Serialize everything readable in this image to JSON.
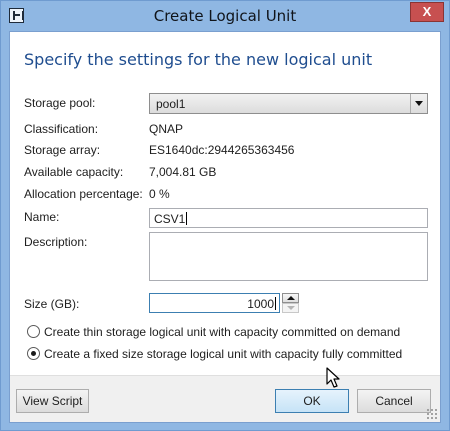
{
  "window": {
    "title": "Create Logical Unit",
    "close_glyph": "X",
    "accent_color": "#8fb7e3"
  },
  "heading": "Specify the settings for the new logical unit",
  "fields": {
    "storage_pool": {
      "label": "Storage pool:",
      "value": "pool1"
    },
    "classification": {
      "label": "Classification:",
      "value": "QNAP"
    },
    "storage_array": {
      "label": "Storage array:",
      "value": "ES1640dc:2944265363456"
    },
    "available_capacity": {
      "label": "Available capacity:",
      "value": "7,004.81 GB"
    },
    "allocation_percentage": {
      "label": "Allocation percentage:",
      "value": "0 %"
    },
    "name": {
      "label": "Name:",
      "value": "CSV1"
    },
    "description": {
      "label": "Description:",
      "value": ""
    },
    "size": {
      "label": "Size (GB):",
      "value": "1000"
    }
  },
  "options": [
    {
      "label": "Create thin storage logical unit with capacity committed on demand",
      "checked": false
    },
    {
      "label": "Create a fixed size storage logical unit with capacity fully committed",
      "checked": true
    }
  ],
  "buttons": {
    "view_script": "View Script",
    "ok": "OK",
    "cancel": "Cancel"
  },
  "icons": {
    "system": "app-menu-icon",
    "dropdown": "chevron-down-icon",
    "spin_up": "spin-up-icon",
    "spin_down": "spin-down-icon",
    "cursor": "mouse-pointer-icon",
    "grip": "resize-grip-icon"
  }
}
